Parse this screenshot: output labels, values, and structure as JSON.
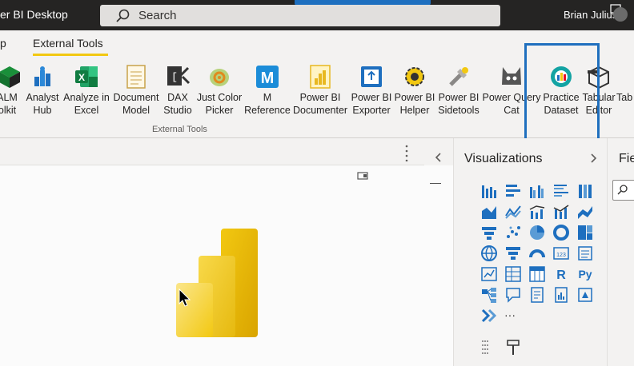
{
  "window": {
    "title": "er BI Desktop",
    "search_placeholder": "Search",
    "user_name": "Brian Julius"
  },
  "ribbon": {
    "tabs": [
      {
        "label": "p",
        "active": false
      },
      {
        "label": "External Tools",
        "active": true
      }
    ],
    "group_label": "External Tools",
    "tools": [
      {
        "line1": "ALM",
        "line2": "olkit",
        "icon": "alm-toolkit-icon"
      },
      {
        "line1": "Analyst",
        "line2": "Hub",
        "icon": "analyst-hub-icon"
      },
      {
        "line1": "Analyze in",
        "line2": "Excel",
        "icon": "excel-icon"
      },
      {
        "line1": "Document",
        "line2": "Model",
        "icon": "document-model-icon"
      },
      {
        "line1": "DAX",
        "line2": "Studio",
        "icon": "dax-studio-icon"
      },
      {
        "line1": "Just Color",
        "line2": "Picker",
        "icon": "chameleon-icon"
      },
      {
        "line1": "M",
        "line2": "Reference",
        "icon": "m-reference-icon"
      },
      {
        "line1": "Power BI",
        "line2": "Documenter",
        "icon": "powerbi-documenter-icon"
      },
      {
        "line1": "Power BI",
        "line2": "Exporter",
        "icon": "powerbi-exporter-icon"
      },
      {
        "line1": "Power BI",
        "line2": "Helper",
        "icon": "powerbi-helper-icon"
      },
      {
        "line1": "Power BI",
        "line2": "Sidetools",
        "icon": "sidetools-icon"
      },
      {
        "line1": "Power Query",
        "line2": "Cat",
        "icon": "cat-icon"
      },
      {
        "line1": "Practice",
        "line2": "Dataset",
        "icon": "practice-dataset-icon"
      },
      {
        "line1": "Tabular",
        "line2": "Editor",
        "icon": "tabular-editor-icon"
      },
      {
        "line1": "Tab",
        "line2": "",
        "icon": "tabular-icon"
      }
    ]
  },
  "visualizations": {
    "title": "Visualizations",
    "r_label": "R",
    "py_label": "Py",
    "more_label": "···",
    "kpi_label": "123"
  },
  "fields": {
    "title": "Fie"
  },
  "splash": {
    "minimize": "—",
    "close": "✕"
  },
  "colors": {
    "accent_yellow": "#f2c811",
    "highlight_blue": "#1f6fbe",
    "title_bar": "#252423"
  }
}
